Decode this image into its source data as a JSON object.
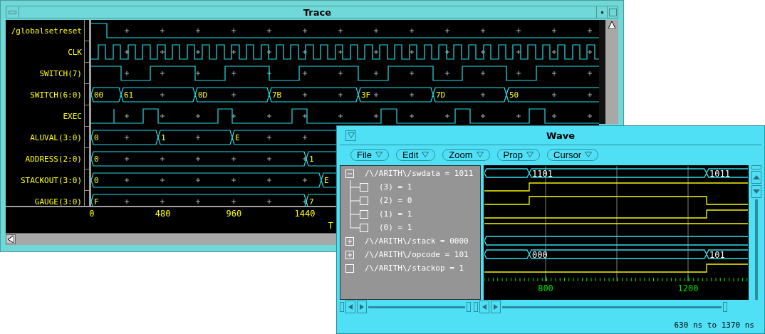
{
  "trace": {
    "title": "Trace",
    "signals": [
      {
        "name": "/globalsetreset",
        "kind": "bit"
      },
      {
        "name": "CLK",
        "kind": "clock"
      },
      {
        "name": "SWITCH(7)",
        "kind": "bit"
      },
      {
        "name": "SWITCH(6:0)",
        "kind": "bus",
        "values": [
          "00",
          "61",
          "0D",
          "7B",
          "3F",
          "7D",
          "50"
        ]
      },
      {
        "name": "EXEC",
        "kind": "bit"
      },
      {
        "name": "ALUVAL(3:0)",
        "kind": "bus",
        "values": [
          "0",
          "1",
          "E"
        ]
      },
      {
        "name": "ADDRESS(2:0)",
        "kind": "bus",
        "values": [
          "0",
          "1"
        ]
      },
      {
        "name": "STACKOUT(3:0)",
        "kind": "bus",
        "values": [
          "0",
          "E"
        ]
      },
      {
        "name": "GAUGE(3:0)",
        "kind": "bus",
        "values": [
          "F",
          "7"
        ]
      }
    ],
    "time_ticks": [
      "0",
      "480",
      "960",
      "1440"
    ],
    "axis_label": "T"
  },
  "wave": {
    "title": "Wave",
    "menus": [
      {
        "label": "File"
      },
      {
        "label": "Edit"
      },
      {
        "label": "Zoom"
      },
      {
        "label": "Prop"
      },
      {
        "label": "Cursor"
      }
    ],
    "signals": [
      {
        "label": "/\\/ARITH\\/swdata = 1011",
        "kind": "bus",
        "expanded": true,
        "values": [
          "1101",
          "1011"
        ],
        "children": [
          {
            "label": "(3) = 1",
            "kind": "bit"
          },
          {
            "label": "(2) = 0",
            "kind": "bit"
          },
          {
            "label": "(1) = 1",
            "kind": "bit"
          },
          {
            "label": "(0) = 1",
            "kind": "bit"
          }
        ]
      },
      {
        "label": "/\\/ARITH\\/stack = 0000",
        "kind": "bus",
        "expanded": false
      },
      {
        "label": "/\\/ARITH\\/opcode = 101",
        "kind": "bus",
        "expanded": false,
        "values": [
          "000",
          "101"
        ]
      },
      {
        "label": "/\\/ARITH\\/stackop = 1",
        "kind": "bit"
      }
    ],
    "ruler_labels": [
      "800",
      "1200"
    ],
    "status": "630 ns to 1370 ns"
  }
}
